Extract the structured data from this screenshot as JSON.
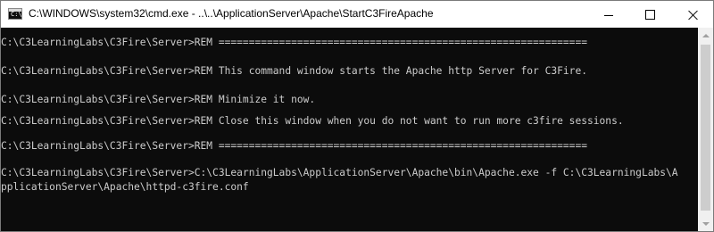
{
  "window": {
    "title": "C:\\WINDOWS\\system32\\cmd.exe - ..\\..\\ApplicationServer\\Apache\\StartC3FireApache",
    "icon": "cmd-icon",
    "icon_text": "C:\\"
  },
  "controls": {
    "minimize": "minimize-icon",
    "maximize": "maximize-icon",
    "close": "close-icon"
  },
  "console": {
    "background": "#0c0c0c",
    "foreground": "#cccccc",
    "lines": [
      "C:\\C3LearningLabs\\C3Fire\\Server>REM =============================================================",
      "",
      "C:\\C3LearningLabs\\C3Fire\\Server>REM This command window starts the Apache http Server for C3Fire.",
      "",
      "C:\\C3LearningLabs\\C3Fire\\Server>REM Minimize it now.",
      "",
      "C:\\C3LearningLabs\\C3Fire\\Server>REM Close this window when you do not want to run more c3fire sessions.",
      "",
      "C:\\C3LearningLabs\\C3Fire\\Server>REM =============================================================",
      "",
      "C:\\C3LearningLabs\\C3Fire\\Server>C:\\C3LearningLabs\\ApplicationServer\\Apache\\bin\\Apache.exe -f C:\\C3LearningLabs\\A",
      "pplicationServer\\Apache\\httpd-c3fire.conf"
    ]
  }
}
